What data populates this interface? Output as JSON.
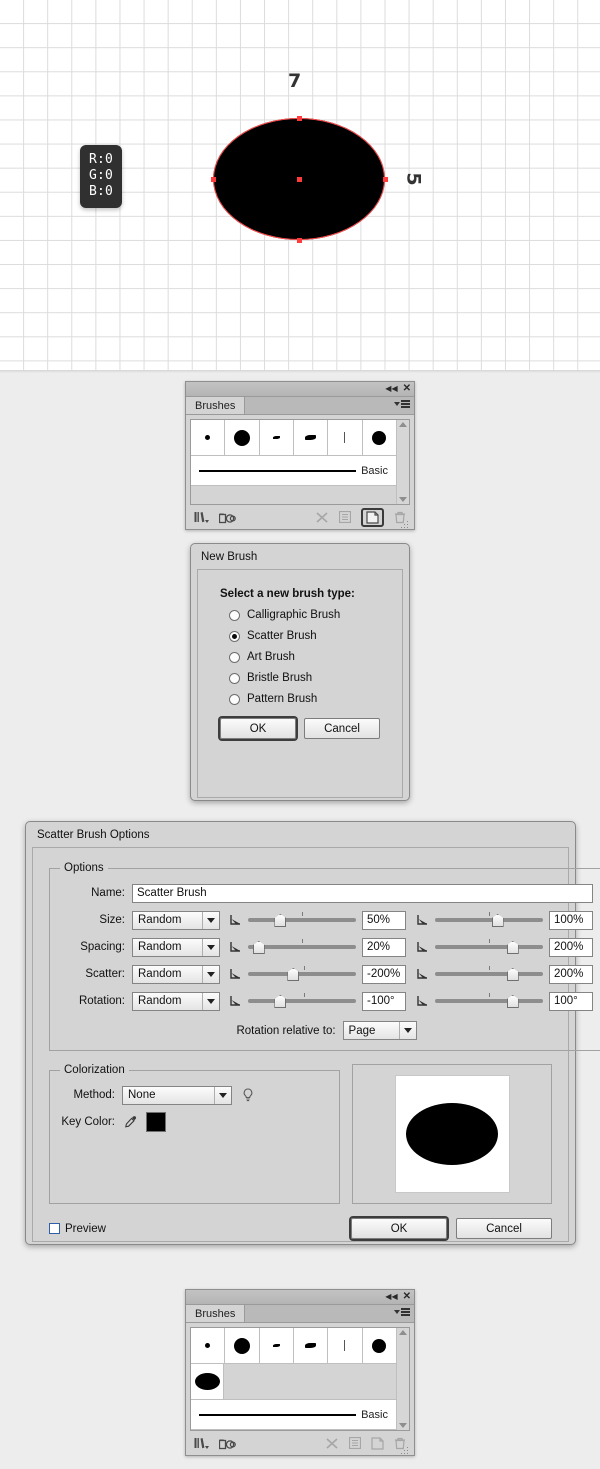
{
  "canvas": {
    "tooltip": {
      "r": "R:0",
      "g": "G:0",
      "b": "B:0"
    },
    "measure_width": "7",
    "measure_height": "5"
  },
  "brushes_panel_top": {
    "tab_label": "Brushes",
    "collapse_icon": "collapse-double-left-icon",
    "close_icon": "close-icon",
    "menu_icon": "panel-menu-icon",
    "stroke_name": "Basic",
    "thumbnails": [
      "small-dot",
      "large-dot",
      "small-taper",
      "medium-taper",
      "thin-line",
      "round-dot"
    ],
    "footer_icons": [
      "brush-libraries-icon",
      "libraries-panel-icon",
      "remove-brush-stroke-icon",
      "brush-options-icon",
      "new-brush-icon",
      "delete-brush-icon"
    ]
  },
  "new_brush_dialog": {
    "title": "New Brush",
    "prompt": "Select a new brush type:",
    "options": [
      {
        "label": "Calligraphic Brush",
        "selected": false
      },
      {
        "label": "Scatter Brush",
        "selected": true
      },
      {
        "label": "Art Brush",
        "selected": false
      },
      {
        "label": "Bristle Brush",
        "selected": false
      },
      {
        "label": "Pattern Brush",
        "selected": false
      }
    ],
    "ok_label": "OK",
    "cancel_label": "Cancel"
  },
  "scatter_dialog": {
    "title": "Scatter Brush Options",
    "options_group": "Options",
    "name_label": "Name:",
    "name_value": "Scatter Brush",
    "rows": [
      {
        "label": "Size:",
        "mode": "Random",
        "min_value": "50%",
        "max_value": "100%",
        "min_pos": 30,
        "max_pos": 58
      },
      {
        "label": "Spacing:",
        "mode": "Random",
        "min_value": "20%",
        "max_value": "200%",
        "min_pos": 10,
        "max_pos": 72
      },
      {
        "label": "Scatter:",
        "mode": "Random",
        "min_value": "-200%",
        "max_value": "200%",
        "min_pos": 42,
        "max_pos": 72
      },
      {
        "label": "Rotation:",
        "mode": "Random",
        "min_value": "-100°",
        "max_value": "100°",
        "min_pos": 30,
        "max_pos": 72
      }
    ],
    "rotation_relative_label": "Rotation relative to:",
    "rotation_relative_value": "Page",
    "colorization_group": "Colorization",
    "method_label": "Method:",
    "method_value": "None",
    "tip_icon": "lightbulb-tip-icon",
    "key_color_label": "Key Color:",
    "eyedropper_icon": "eyedropper-icon",
    "key_color_hex": "#000000",
    "preview_label": "Preview",
    "preview_checked": false,
    "ok_label": "OK",
    "cancel_label": "Cancel"
  },
  "brushes_panel_bottom": {
    "tab_label": "Brushes",
    "collapse_icon": "collapse-double-left-icon",
    "close_icon": "close-icon",
    "menu_icon": "panel-menu-icon",
    "stroke_name": "Basic",
    "thumbnails": [
      "small-dot",
      "large-dot",
      "small-taper",
      "medium-taper",
      "thin-line",
      "round-dot"
    ],
    "new_thumbnail": "scatter-ellipse-brush",
    "footer_icons": [
      "brush-libraries-icon",
      "libraries-panel-icon",
      "remove-brush-stroke-icon",
      "brush-options-icon",
      "new-brush-icon",
      "delete-brush-icon"
    ]
  },
  "colors": {
    "panel_bg": "#d4d4d4",
    "accent_anchor": "#ff3b3b",
    "shape_fill": "#000000",
    "page_bg": "#ededed"
  }
}
